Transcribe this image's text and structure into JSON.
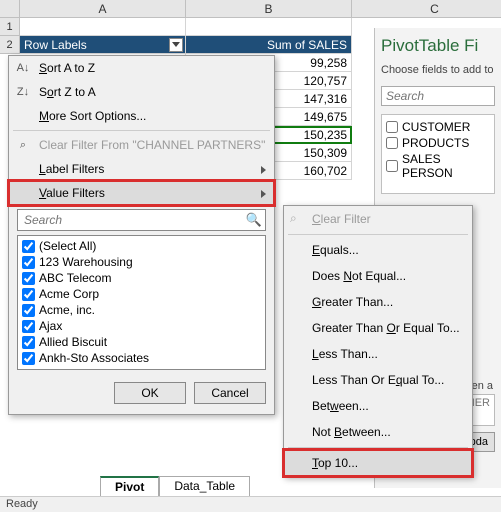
{
  "columns": [
    "A",
    "B",
    "C"
  ],
  "rownum_start": 1,
  "pivot": {
    "row_labels": "Row Labels",
    "sum_label": "Sum of SALES",
    "values": [
      "99,258",
      "120,757",
      "147,316",
      "149,675",
      "150,235",
      "150,309",
      "160,702"
    ]
  },
  "menu": {
    "sort_az": "Sort A to Z",
    "sort_za": "Sort Z to A",
    "more_sort": "More Sort Options...",
    "clear_filter": "Clear Filter From \"CHANNEL PARTNERS\"",
    "label_filters": "Label Filters",
    "value_filters": "Value Filters",
    "search_placeholder": "Search",
    "check_items": [
      "(Select All)",
      "123 Warehousing",
      "ABC Telecom",
      "Acme Corp",
      "Acme, inc.",
      "Ajax",
      "Allied Biscuit",
      "Ankh-Sto Associates"
    ],
    "ok": "OK",
    "cancel": "Cancel"
  },
  "submenu": {
    "clear_filter": "Clear Filter",
    "equals": "Equals...",
    "not_equal": "Does Not Equal...",
    "gt": "Greater Than...",
    "gte": "Greater Than Or Equal To...",
    "lt": "Less Than...",
    "lte": "Less Than Or Equal To...",
    "between": "Between...",
    "not_between": "Not Between...",
    "top10": "Top 10..."
  },
  "fields": {
    "title": "PivotTable Fi",
    "desc": "Choose fields to add to",
    "search_placeholder": "Search",
    "items": [
      "CUSTOMER",
      "PRODUCTS",
      "SALES PERSON"
    ],
    "zone_hint": "NER",
    "update": "Upda"
  },
  "tabs": {
    "pivot": "Pivot",
    "data": "Data_Table"
  },
  "status": "Ready"
}
